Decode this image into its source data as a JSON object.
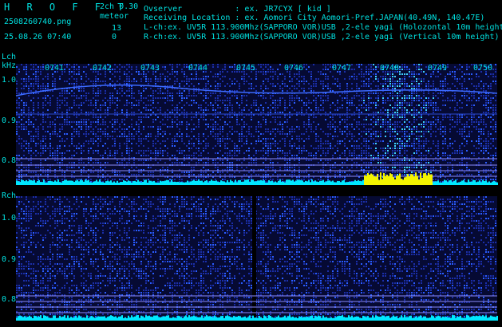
{
  "header": {
    "brand": "H R O F F T",
    "mode": "2ch 0.30",
    "filename": "2508260740.png",
    "datetime": "25.08.26 07:40",
    "meteor_label": "meteor",
    "lch_count": "13",
    "rch_count": "0",
    "observer_line": "Ovserver           : ex. JR7CYX [ kid ]",
    "location_line": "Receiving Location : ex. Aomori City Aomori-Pref.JAPAN(40.49N, 140.47E)",
    "lch_line": "L-ch:ex. UV5R 113.900Mhz(SAPPORO VOR)USB ,2-ele yagi (Holozontal 10m height)",
    "rch_line": "R-ch:ex. UV5R 113.900Mhz(SAPPORO VOR)USB ,2-ele yagi (Vertical 10m height)"
  },
  "time_ticks": [
    "0741",
    "0742",
    "0743",
    "0744",
    "0745",
    "0746",
    "0747",
    "0748",
    "0749",
    "0750"
  ],
  "lch_panel": {
    "label": "Lch",
    "unit": "kHz",
    "y_ticks": [
      "1.0",
      "0.9",
      "0.8"
    ]
  },
  "rch_panel": {
    "label": "Rch",
    "y_ticks": [
      "1.0",
      "0.9",
      "0.8"
    ]
  },
  "colors": {
    "background": "#000000",
    "noise_blue": "#1a2dbf",
    "level_cyan": "#00e8ff",
    "level_yellow": "#f4f400",
    "brand_cyan": "#00e0e0",
    "text": "#cccccc"
  }
}
